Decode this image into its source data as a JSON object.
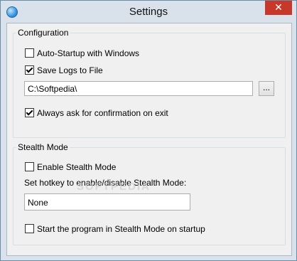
{
  "window": {
    "title": "Settings",
    "close_label": "✕"
  },
  "config_group": {
    "legend": "Configuration",
    "auto_startup": {
      "label": "Auto-Startup with Windows",
      "checked": false
    },
    "save_logs": {
      "label": "Save Logs to File",
      "checked": true
    },
    "log_path": {
      "value": "C:\\Softpedia\\"
    },
    "browse_label": "...",
    "confirm_exit": {
      "label": "Always ask for confirmation on exit",
      "checked": true
    }
  },
  "stealth_group": {
    "legend": "Stealth Mode",
    "enable": {
      "label": "Enable Stealth Mode",
      "checked": false
    },
    "hotkey_label": "Set hotkey to enable/disable Stealth Mode:",
    "hotkey_value": "None",
    "start_in_stealth": {
      "label": "Start the program in Stealth Mode on startup",
      "checked": false
    }
  },
  "watermark": "SOFTPEDIA"
}
